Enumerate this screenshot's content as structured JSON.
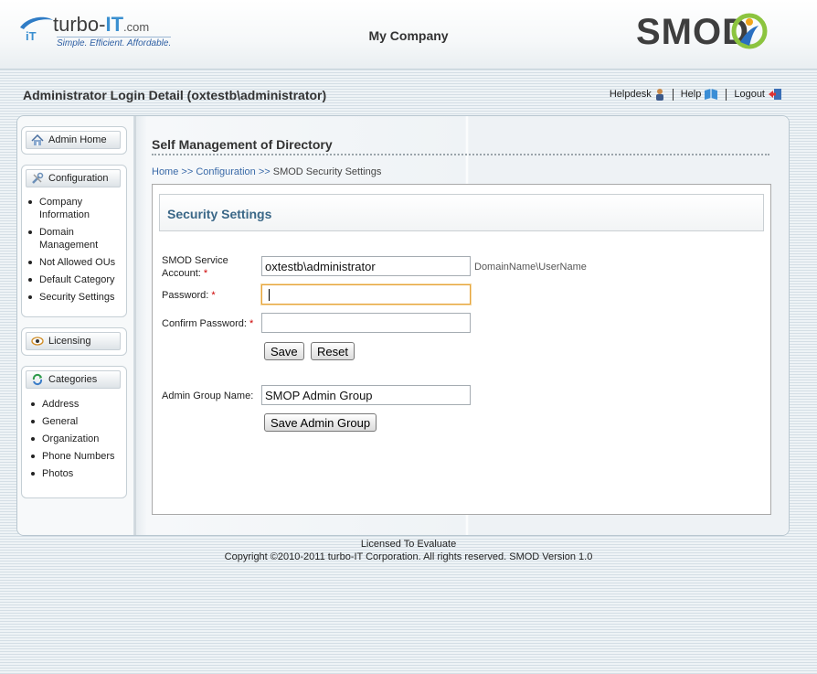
{
  "header": {
    "logo_brand_pre": "turbo-",
    "logo_brand_accent": "IT",
    "logo_brand_suffix": ".com",
    "logo_tagline": "Simple.  Efficient.  Affordable.",
    "company": "My Company",
    "product_logo": "SMOD"
  },
  "subheader": {
    "title": "Administrator Login Detail (oxtestb\\administrator)",
    "links": [
      {
        "label": "Helpdesk",
        "icon": "person-icon"
      },
      {
        "label": "Help",
        "icon": "book-icon"
      },
      {
        "label": "Logout",
        "icon": "exit-door-icon"
      }
    ]
  },
  "sidebar": {
    "admin_home": {
      "label": "Admin Home",
      "icon": "home-icon"
    },
    "configuration": {
      "label": "Configuration",
      "icon": "tools-icon",
      "items": [
        "Company Information",
        "Domain Management",
        "Not Allowed OUs",
        "Default Category",
        "Security Settings"
      ]
    },
    "licensing": {
      "label": "Licensing",
      "icon": "eye-icon"
    },
    "categories": {
      "label": "Categories",
      "icon": "refresh-icon",
      "items": [
        "Address",
        "General",
        "Organization",
        "Phone Numbers",
        "Photos"
      ]
    }
  },
  "main": {
    "title": "Self Management of Directory",
    "breadcrumb": {
      "home": "Home",
      "sep": ">>",
      "configuration": "Configuration",
      "current": "SMOD Security Settings"
    },
    "section_title": "Security Settings",
    "form": {
      "service_account_label_1": "SMOD Service",
      "service_account_label_2": "Account:",
      "service_account_value": "oxtestb\\administrator",
      "service_account_hint": "DomainName\\UserName",
      "password_label": "Password:",
      "password_value": "",
      "confirm_password_label": "Confirm Password:",
      "confirm_password_value": "",
      "required_mark": "*",
      "save_label": "Save",
      "reset_label": "Reset",
      "admin_group_label": "Admin Group Name:",
      "admin_group_value": "SMOP Admin Group",
      "save_admin_group_label": "Save Admin Group"
    }
  },
  "footer": {
    "license": "Licensed To Evaluate",
    "copyright": "Copyright ©2010-2011 turbo-IT Corporation. All rights reserved. SMOD Version 1.0"
  },
  "colors": {
    "accent": "#3a6787",
    "link": "#3a6aa8",
    "required": "#cc0000",
    "focus": "#e5a33c"
  }
}
